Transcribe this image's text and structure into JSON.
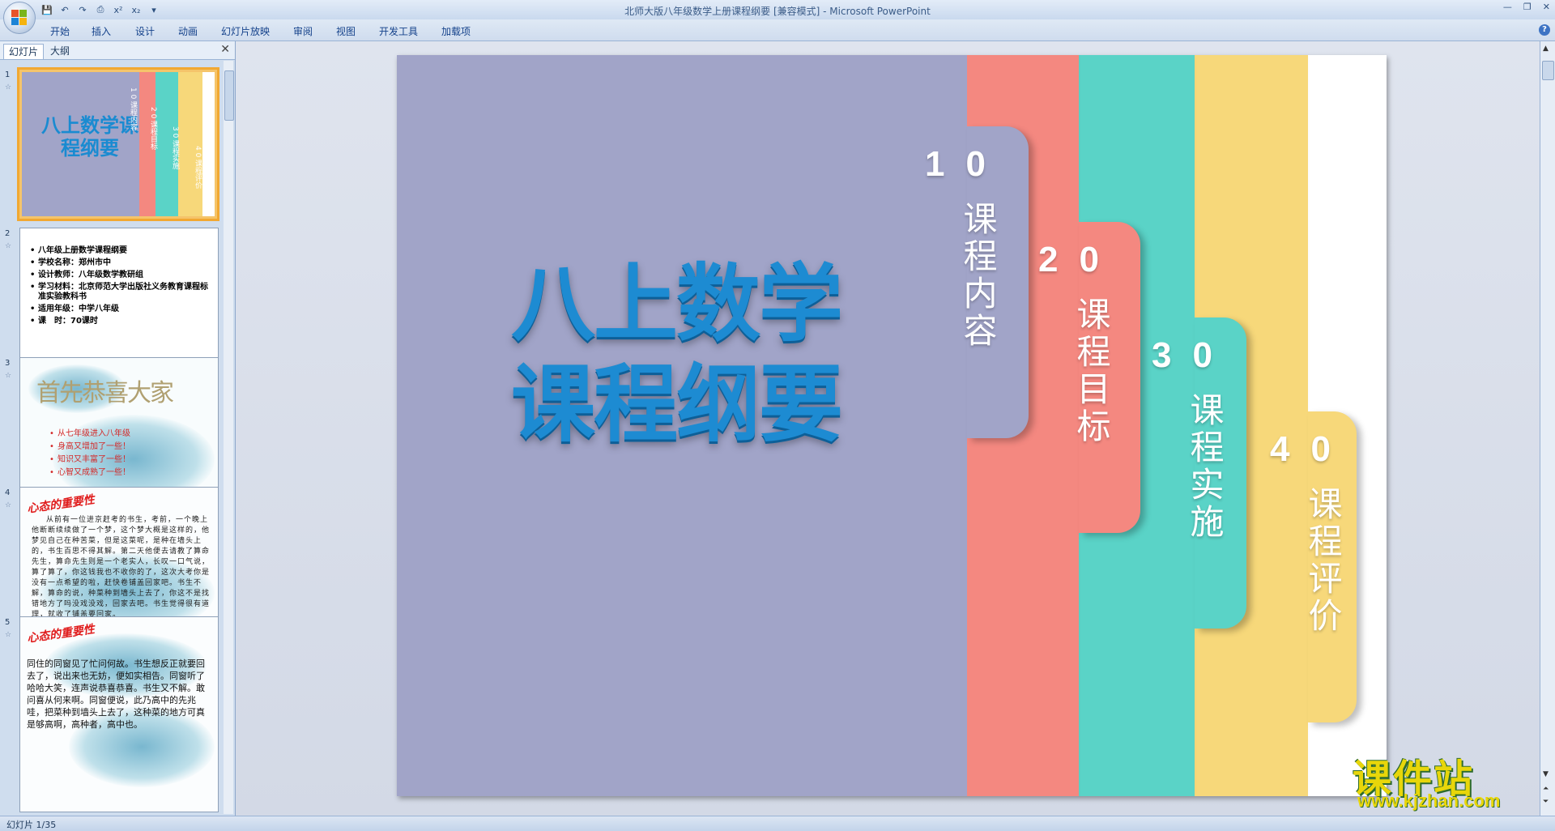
{
  "window": {
    "title": "北师大版八年级数学上册课程纲要 [兼容模式] - Microsoft PowerPoint"
  },
  "ribbon": {
    "tabs": [
      "开始",
      "插入",
      "设计",
      "动画",
      "幻灯片放映",
      "审阅",
      "视图",
      "开发工具",
      "加载项"
    ]
  },
  "pane": {
    "tab_slides": "幻灯片",
    "tab_outline": "大纲"
  },
  "thumbs": {
    "s1": {
      "num": "1",
      "title": "八上数学课程纲要",
      "tabs": [
        "1 0 课程内容",
        "2 0 课程目标",
        "3 0 课程实施",
        "4 0 课程评价"
      ]
    },
    "s2": {
      "num": "2",
      "items": [
        "八年级上册数学课程纲要",
        "学校名称：郑州市中",
        "设计教师：八年级数学教研组",
        "学习材料：北京师范大学出版社义务教育课程标准实验教科书",
        "适用年级：中学八年级",
        "课　时：70课时"
      ]
    },
    "s3": {
      "num": "3",
      "title": "首先恭喜大家",
      "items": [
        "从七年级进入八年级",
        "身高又增加了一些！",
        "知识又丰富了一些！",
        "心智又成熟了一些！"
      ]
    },
    "s4": {
      "num": "4",
      "title": "心态的重要性",
      "body": "从前有一位进京赶考的书生，考前，一个晚上他断断续续做了一个梦，这个梦大概是这样的，他梦见自己在种苦菜，但是这菜呢，是种在墙头上的，书生百思不得其解。第二天他便去请教了算命先生，算命先生则是一个老实人，长叹一口气说，算了算了，你这钱我也不收你的了，这次大考你是没有一点希望的啦，赶快卷铺盖回家吧。书生不解，算命的说，种菜种到墙头上去了，你这不是找错地方了吗没戏没戏，回家去吧。书生觉得很有道理，就收了铺盖要回家。"
    },
    "s5": {
      "num": "5",
      "title": "心态的重要性",
      "body": "同住的同窗见了忙问何故。书生想反正就要回去了，说出来也无妨，便如实相告。同窗听了哈哈大笑，连声说恭喜恭喜。书生又不解。敢问喜从何来啊。同窗便说，此乃高中的先兆哇，把菜种到墙头上去了，这种菜的地方可真是够高啊，高种者，高中也。"
    }
  },
  "slide": {
    "title_line1": "八上数学",
    "title_line2": "课程纲要",
    "sections": [
      {
        "num": "10",
        "label": "课程内容",
        "color": "#a1a4c8"
      },
      {
        "num": "20",
        "label": "课程目标",
        "color": "#f48880"
      },
      {
        "num": "30",
        "label": "课程实施",
        "color": "#5ad3c7"
      },
      {
        "num": "40",
        "label": "课程评价",
        "color": "#f7d87a"
      }
    ],
    "bg_color": "#a1a4c8"
  },
  "status": {
    "slide_counter": "幻灯片 1/35"
  },
  "watermark": {
    "line1": "课件站",
    "line2": "www.kjzhan.com"
  }
}
